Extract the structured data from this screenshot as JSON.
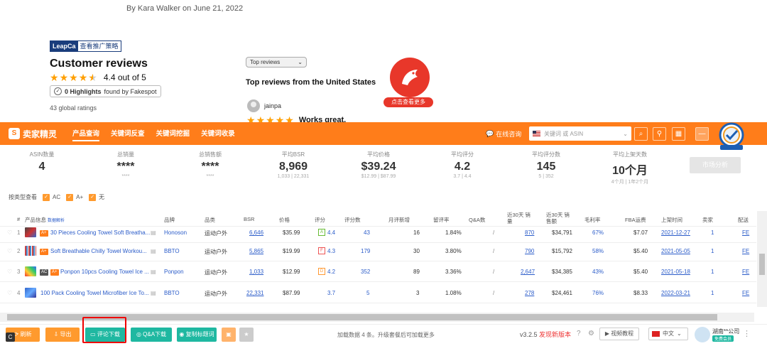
{
  "amazon": {
    "byline": "By Kara Walker on June 21, 2022",
    "leapca_logo": "LeapCa",
    "leapca_link": "查看推广策略",
    "reviews_title": "Customer reviews",
    "rating_text": "4.4 out of 5",
    "rating_value": 4.4,
    "highlights_count": "0 Highlights",
    "highlights_suffix": "found by Fakespot",
    "global_ratings": "43 global ratings",
    "sort_select": "Top reviews",
    "top_reviews_title": "Top reviews from the United States",
    "reviewer_name": "jainpa",
    "review_title": "Works great.",
    "promo_button": "点击查看更多"
  },
  "toolbar": {
    "brand": "卖家精灵",
    "nav": [
      "产品查询",
      "关键词反查",
      "关键词挖掘",
      "关键词收录"
    ],
    "online": "在线咨询",
    "search_placeholder": "关键词 或 ASIN"
  },
  "stats": [
    {
      "label": "ASIN数量",
      "value": "4",
      "sub": ""
    },
    {
      "label": "总销量",
      "value": "****",
      "sub": "****"
    },
    {
      "label": "总销售额",
      "value": "****",
      "sub": "****"
    },
    {
      "label": "平均BSR",
      "value": "8,969",
      "sub": "1,033 | 22,331"
    },
    {
      "label": "平均价格",
      "value": "$39.24",
      "sub": "$12.99 | $87.99"
    },
    {
      "label": "平均评分",
      "value": "4.2",
      "sub": "3.7 | 4.4"
    },
    {
      "label": "平均评分数",
      "value": "145",
      "sub": "5 | 352"
    },
    {
      "label": "平均上架天数",
      "value": "10个月",
      "sub": "4个月 | 1年2个月"
    }
  ],
  "market_button": "市场分析",
  "type_filter": {
    "label": "按类型查看",
    "options": [
      "AC",
      "A+",
      "无"
    ]
  },
  "table": {
    "headers": [
      "#",
      "产品信息",
      "数据解析",
      "品牌",
      "品类",
      "BSR",
      "价格",
      "评分",
      "评分数",
      "月评新增",
      "留评率",
      "Q&A数",
      "近30天 销量",
      "近30天 销售额",
      "毛利率",
      "FBA运费",
      "上架时间",
      "卖家",
      "配送"
    ],
    "rows": [
      {
        "idx": "1",
        "title": "30 Pieces Cooling Towel Soft Breatha...",
        "badges": [
          "A+"
        ],
        "brand": "Honoson",
        "category": "运动户外",
        "bsr": "6,646",
        "price": "$35.99",
        "score_badge": "A",
        "rating": "4.4",
        "reviews": "43",
        "monthly": "16",
        "rate": "1.84%",
        "qa": "/",
        "sales": "870",
        "revenue": "$34,791",
        "margin": "67%",
        "fba": "$7.07",
        "date": "2021-12-27",
        "sellers": "1",
        "ship": "FE"
      },
      {
        "idx": "2",
        "title": "Soft Breathable Chilly Towel Workou...",
        "badges": [
          "A+"
        ],
        "brand": "BBTO",
        "category": "运动户外",
        "bsr": "5,865",
        "price": "$19.99",
        "score_badge": "F",
        "rating": "4.3",
        "reviews": "179",
        "monthly": "30",
        "rate": "3.80%",
        "qa": "/",
        "sales": "790",
        "revenue": "$15,792",
        "margin": "58%",
        "fba": "$5.40",
        "date": "2021-05-05",
        "sellers": "1",
        "ship": "FE"
      },
      {
        "idx": "3",
        "title": "Ponpon 10pcs Cooling Towel Ice ...",
        "badges": [
          "AC",
          "A+"
        ],
        "brand": "Ponpon",
        "category": "运动户外",
        "bsr": "1,033",
        "price": "$12.99",
        "score_badge": "D",
        "rating": "4.2",
        "reviews": "352",
        "monthly": "89",
        "rate": "3.36%",
        "qa": "/",
        "sales": "2,647",
        "revenue": "$34,385",
        "margin": "43%",
        "fba": "$5.40",
        "date": "2021-05-18",
        "sellers": "1",
        "ship": "FE"
      },
      {
        "idx": "4",
        "title": "100 Pack Cooling Towel Microfiber Ice To...",
        "badges": [],
        "brand": "BBTO",
        "category": "运动户外",
        "bsr": "22,331",
        "price": "$87.99",
        "score_badge": "",
        "rating": "3.7",
        "reviews": "5",
        "monthly": "3",
        "rate": "1.08%",
        "qa": "/",
        "sales": "278",
        "revenue": "$24,461",
        "margin": "76%",
        "fba": "$8.33",
        "date": "2022-03-21",
        "sellers": "1",
        "ship": "FE"
      }
    ]
  },
  "bottom": {
    "buttons": [
      "刷新",
      "导出",
      "评论下载",
      "Q&A下载",
      "复制标题词"
    ],
    "load_text": "加载数据 4 条。升级套餐后可加载更多",
    "version": "v3.2.5",
    "new_version": "发现新版本",
    "video": "视频教程",
    "lang": "中文",
    "user": "湖南**公司",
    "user_badge": "免费会员"
  },
  "colors": {
    "orange": "#ff7d1a",
    "teal": "#1fb8a1",
    "link": "#2b5cc9",
    "red": "#e8372a"
  }
}
